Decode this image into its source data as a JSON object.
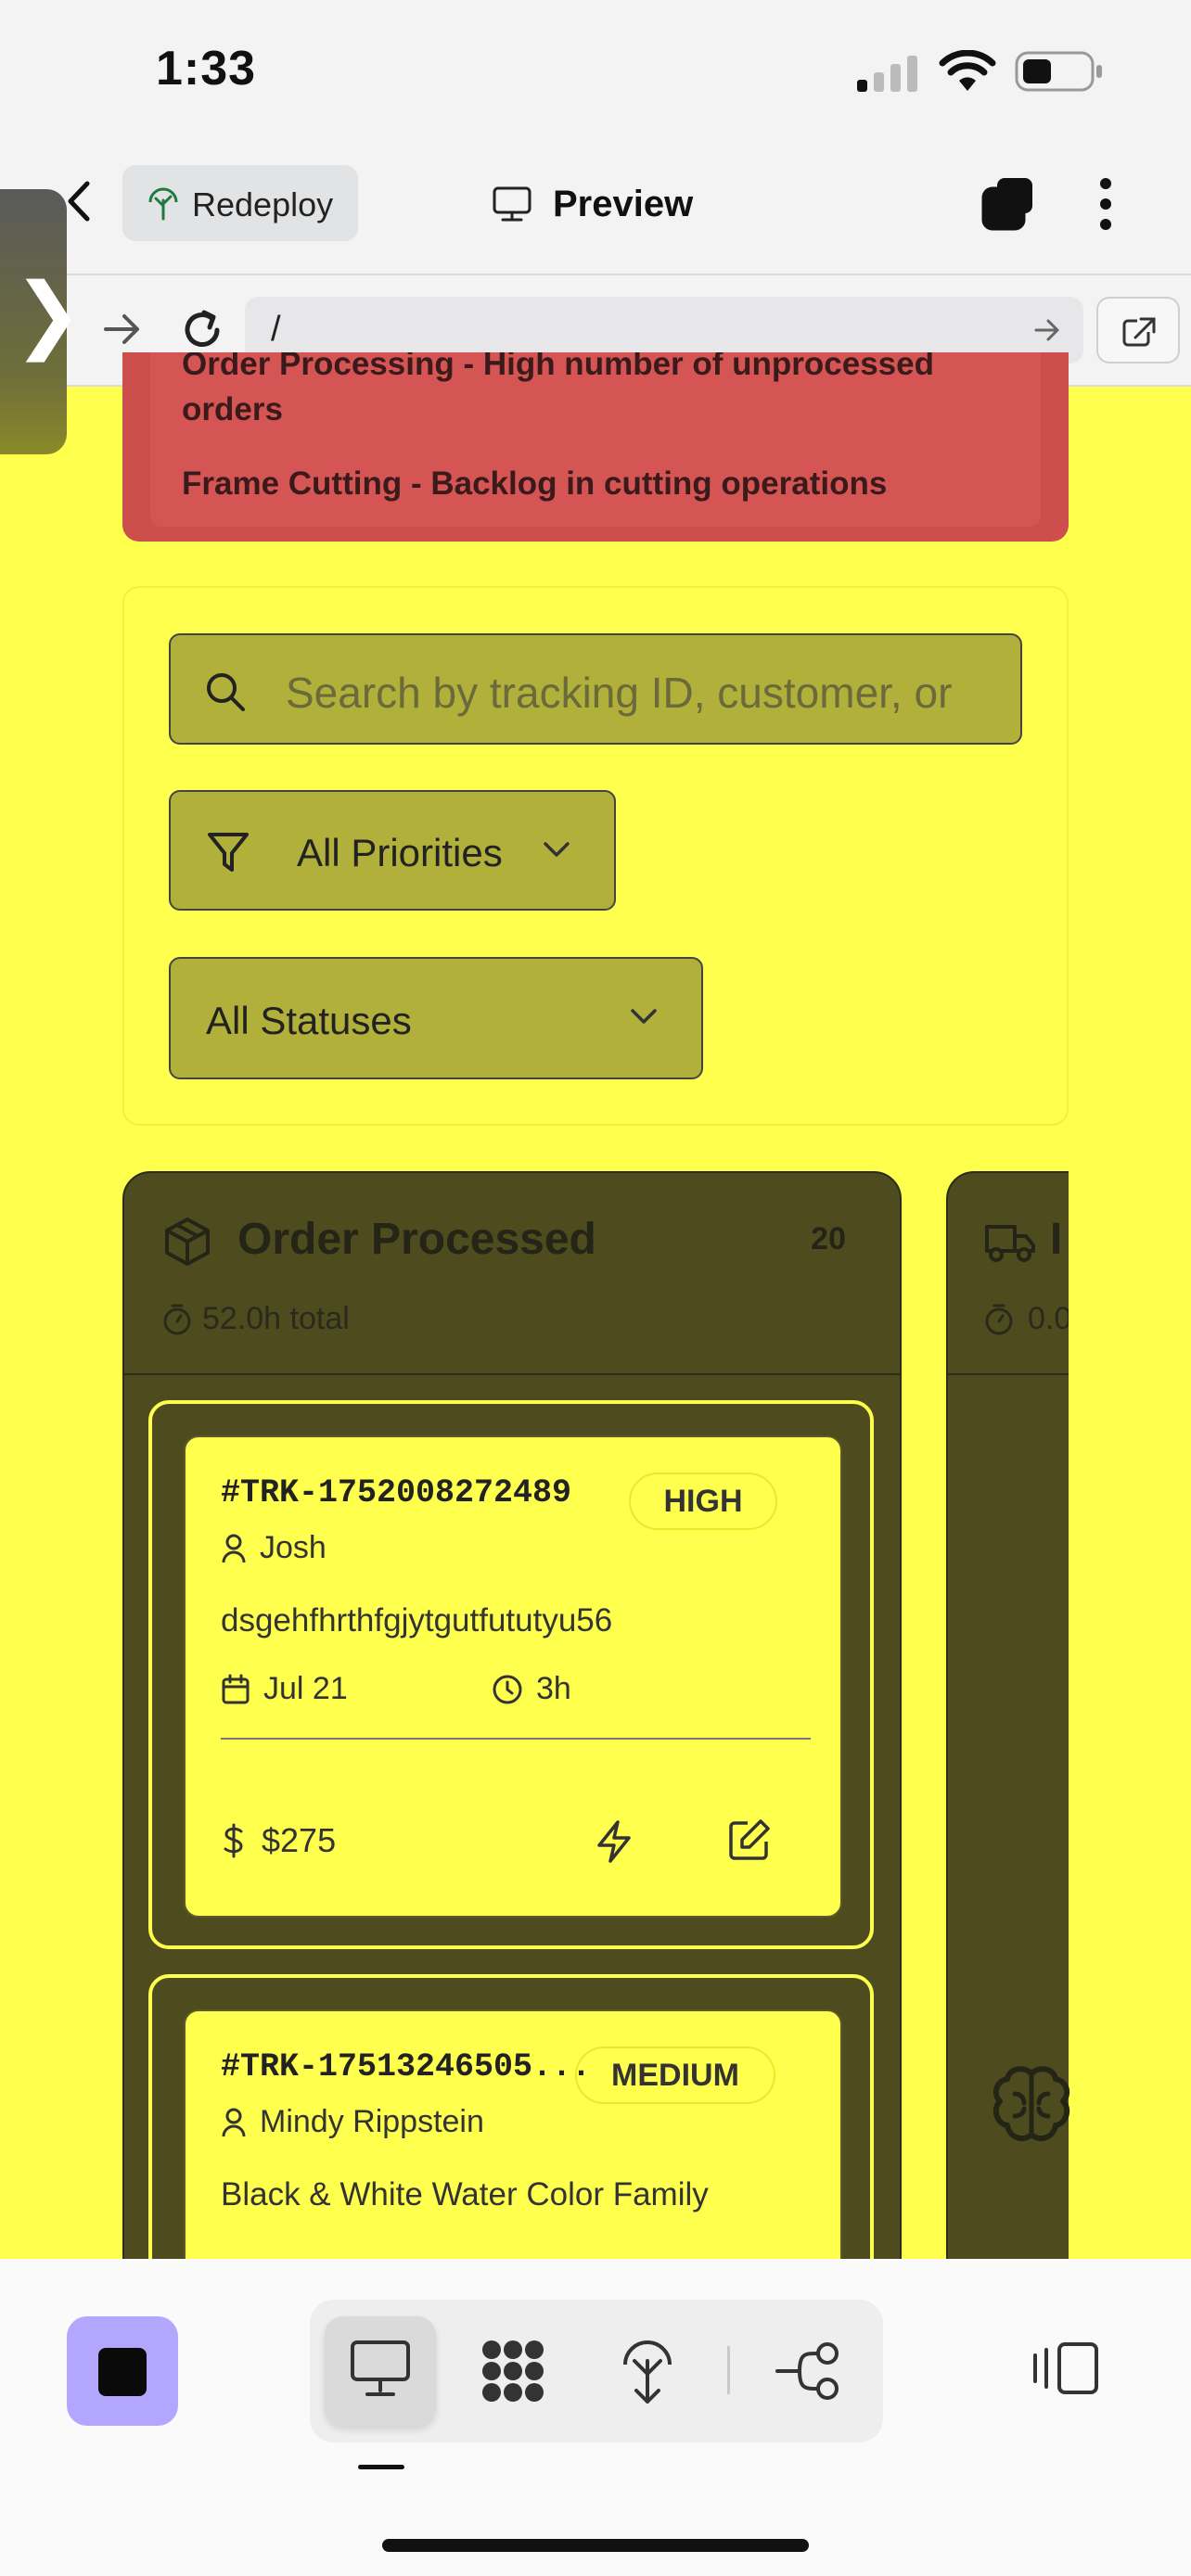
{
  "status_bar": {
    "time": "1:33"
  },
  "toolbar": {
    "redeploy_label": "Redeploy",
    "preview_label": "Preview"
  },
  "url_bar": {
    "url": "/"
  },
  "alerts": {
    "line1": "Order Processing - High number of unprocessed",
    "line1b": "orders",
    "line2": "Frame Cutting - Backlog in cutting operations"
  },
  "filters": {
    "search_placeholder": "Search by tracking ID, customer, or",
    "priority_label": "All Priorities",
    "status_label": "All Statuses"
  },
  "board": {
    "column": {
      "title": "Order Processed",
      "count": "20",
      "total_time": "52.0h total"
    },
    "column2": {
      "title_fragment": "I",
      "total_time_fragment": "0.0"
    },
    "cards": [
      {
        "tracking": "#TRK-1752008272489",
        "priority": "HIGH",
        "customer": "Josh",
        "description": "dsgehfhrthfgjytgutfututyu56",
        "date": "Jul 21",
        "duration": "3h",
        "price": "$275"
      },
      {
        "tracking": "#TRK-17513246505...",
        "priority": "MEDIUM",
        "customer": "Mindy Rippstein",
        "description": "Black & White Water Color Family"
      }
    ]
  },
  "colors": {
    "background": "#ffff4d",
    "column": "#4e4c1e",
    "alert": "#cc4f4d",
    "stop_button": "#b3a6ff"
  }
}
